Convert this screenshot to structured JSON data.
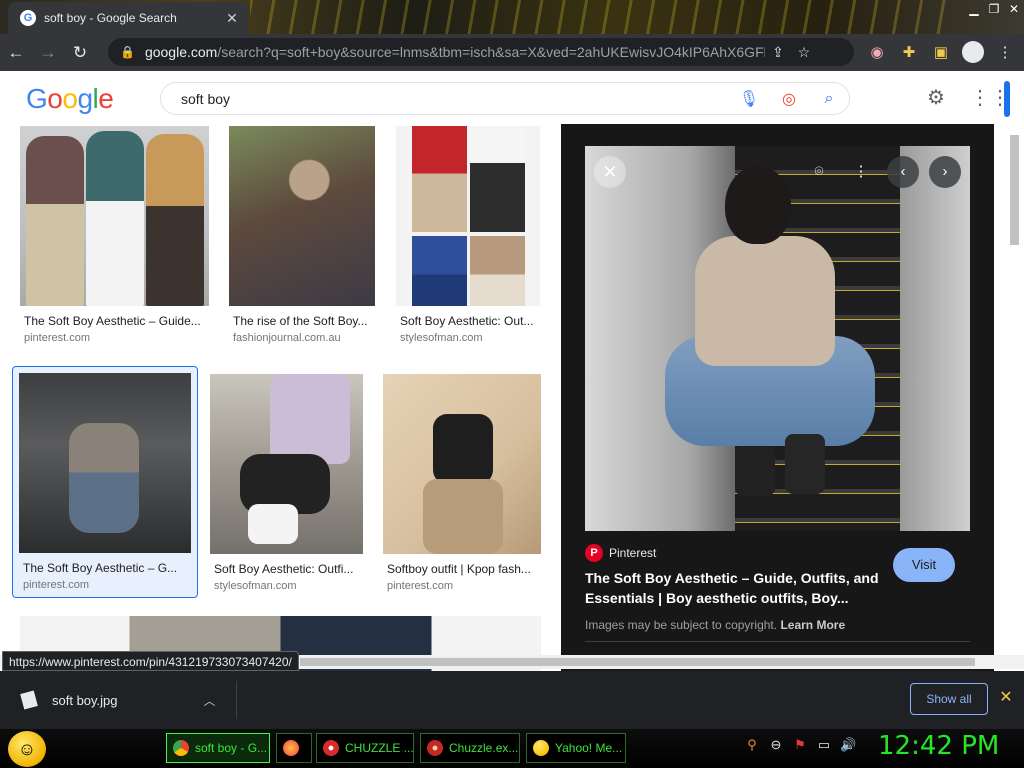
{
  "browser": {
    "tab_title": "soft boy - Google Search",
    "tab_close": "✕",
    "url_domain": "google.com",
    "url_rest": "/search?q=soft+boy&source=lnms&tbm=isch&sa=X&ved=2ahUKEwisvJO4kIP6AhX6GFkF...",
    "window_controls": [
      "▁",
      "❐",
      "✕"
    ]
  },
  "google": {
    "logo": "Google",
    "query": "soft boy"
  },
  "results": [
    {
      "title": "The Soft Boy Aesthetic – Guide...",
      "source": "pinterest.com"
    },
    {
      "title": "The rise of the Soft Boy...",
      "source": "fashionjournal.com.au"
    },
    {
      "title": "Soft Boy Aesthetic: Out...",
      "source": "stylesofman.com"
    },
    {
      "title": "The Soft Boy Aesthetic – G...",
      "source": "pinterest.com"
    },
    {
      "title": "Soft Boy Aesthetic: Outfi...",
      "source": "stylesofman.com"
    },
    {
      "title": "Softboy outfit | Kpop fash...",
      "source": "pinterest.com"
    }
  ],
  "preview": {
    "source_name": "Pinterest",
    "title": "The Soft Boy Aesthetic – Guide, Outfits, and Essentials | Boy aesthetic outfits, Boy...",
    "visit_label": "Visit",
    "copyright_text": "Images may be subject to copyright.",
    "learn_more": "Learn More"
  },
  "status_url": "https://www.pinterest.com/pin/431219733073407420/",
  "download": {
    "filename": "soft boy.jpg",
    "show_all": "Show all"
  },
  "taskbar": {
    "tasks": [
      {
        "label": "soft boy - G...",
        "icon_color": "#4285f4"
      },
      {
        "label": "",
        "icon_color": "#ff7139"
      },
      {
        "label": "CHUZZLE ...",
        "icon_color": "#d92b2b"
      },
      {
        "label": "Chuzzle.ex...",
        "icon_color": "#c62828"
      },
      {
        "label": "Yahoo! Me...",
        "icon_color": "#f4c20d"
      }
    ],
    "clock": "12:42 PM"
  },
  "colors": {
    "accent_blue": "#1a73e8",
    "visit_button": "#8ab4f8",
    "taskbar_text": "#3ee33e",
    "clock": "#27e627"
  }
}
